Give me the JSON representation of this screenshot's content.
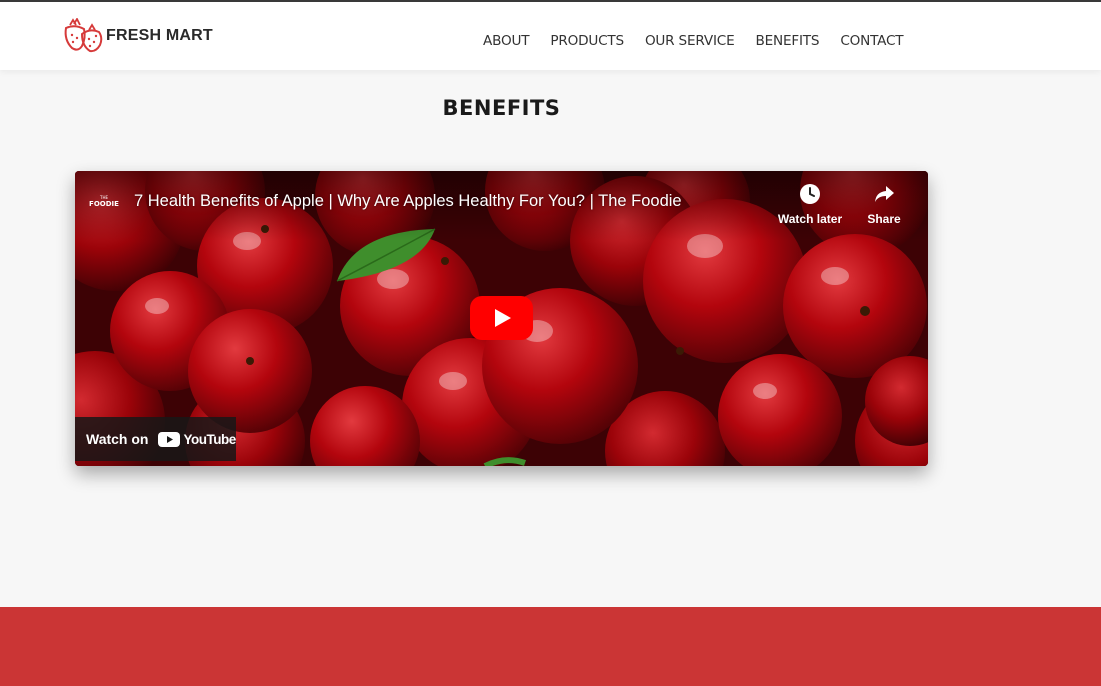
{
  "brand": {
    "name": "FRESH MART"
  },
  "nav": {
    "items": [
      "ABOUT",
      "PRODUCTS",
      "OUR SERVICE",
      "BENEFITS",
      "CONTACT"
    ]
  },
  "section": {
    "title": "BENEFITS"
  },
  "video": {
    "title": "7 Health Benefits of Apple | Why Are Apples Healthy For You? | The Foodie",
    "channel_small": "THE",
    "channel_name": "FOODIE",
    "watch_later_label": "Watch later",
    "share_label": "Share",
    "watch_on_label": "Watch on",
    "youtube_wordmark": "YouTube",
    "icons": [
      "clock-icon",
      "share-arrow-icon",
      "play-button-icon",
      "youtube-logo-icon"
    ],
    "colors": {
      "play_red": "#ff0000",
      "apple_red": "#b3050d"
    }
  },
  "theme": {
    "footer_color": "#cb3535",
    "logo_red": "#d63a3a"
  }
}
